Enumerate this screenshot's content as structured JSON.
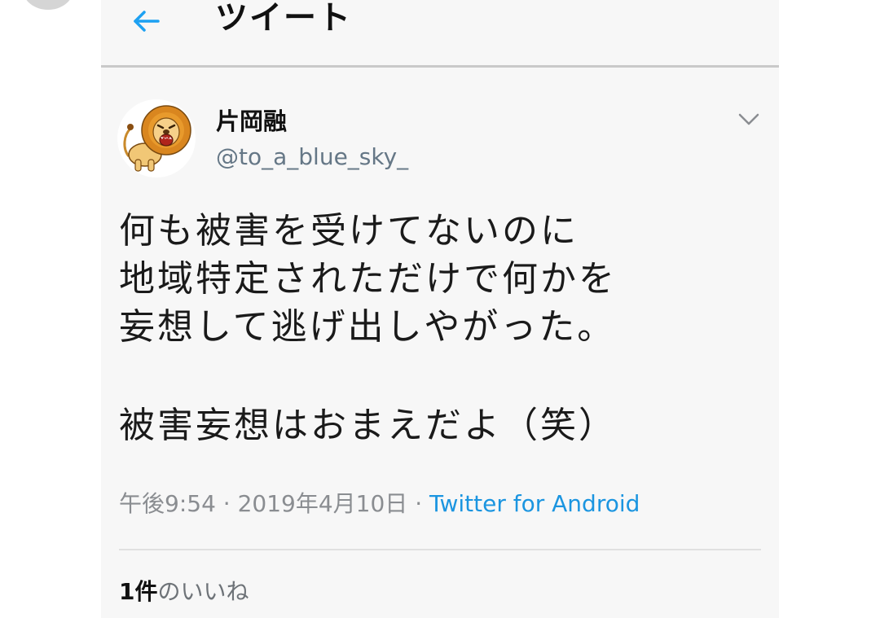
{
  "header": {
    "title": "ツイート",
    "back_icon": "arrow-left-icon",
    "accent_color": "#1da1f2"
  },
  "tweet": {
    "author": {
      "display_name": "片岡融",
      "handle": "@to_a_blue_sky_",
      "avatar_icon": "lion-avatar"
    },
    "menu_icon": "chevron-down-icon",
    "lines": [
      "何も被害を受けてないのに",
      "地域特定されただけで何かを",
      "妄想して逃げ出しやがった。"
    ],
    "closing_line": "被害妄想はおまえだよ（笑）",
    "meta": {
      "time": "午後9:54",
      "separator": " · ",
      "date": "2019年4月10日",
      "source": "Twitter for Android"
    },
    "likes": {
      "count": "1",
      "unit": "件",
      "label": "のいいね"
    }
  },
  "colors": {
    "panel_bg": "#f7f7f7",
    "link": "#1b95e0",
    "muted": "#8a8d91"
  }
}
